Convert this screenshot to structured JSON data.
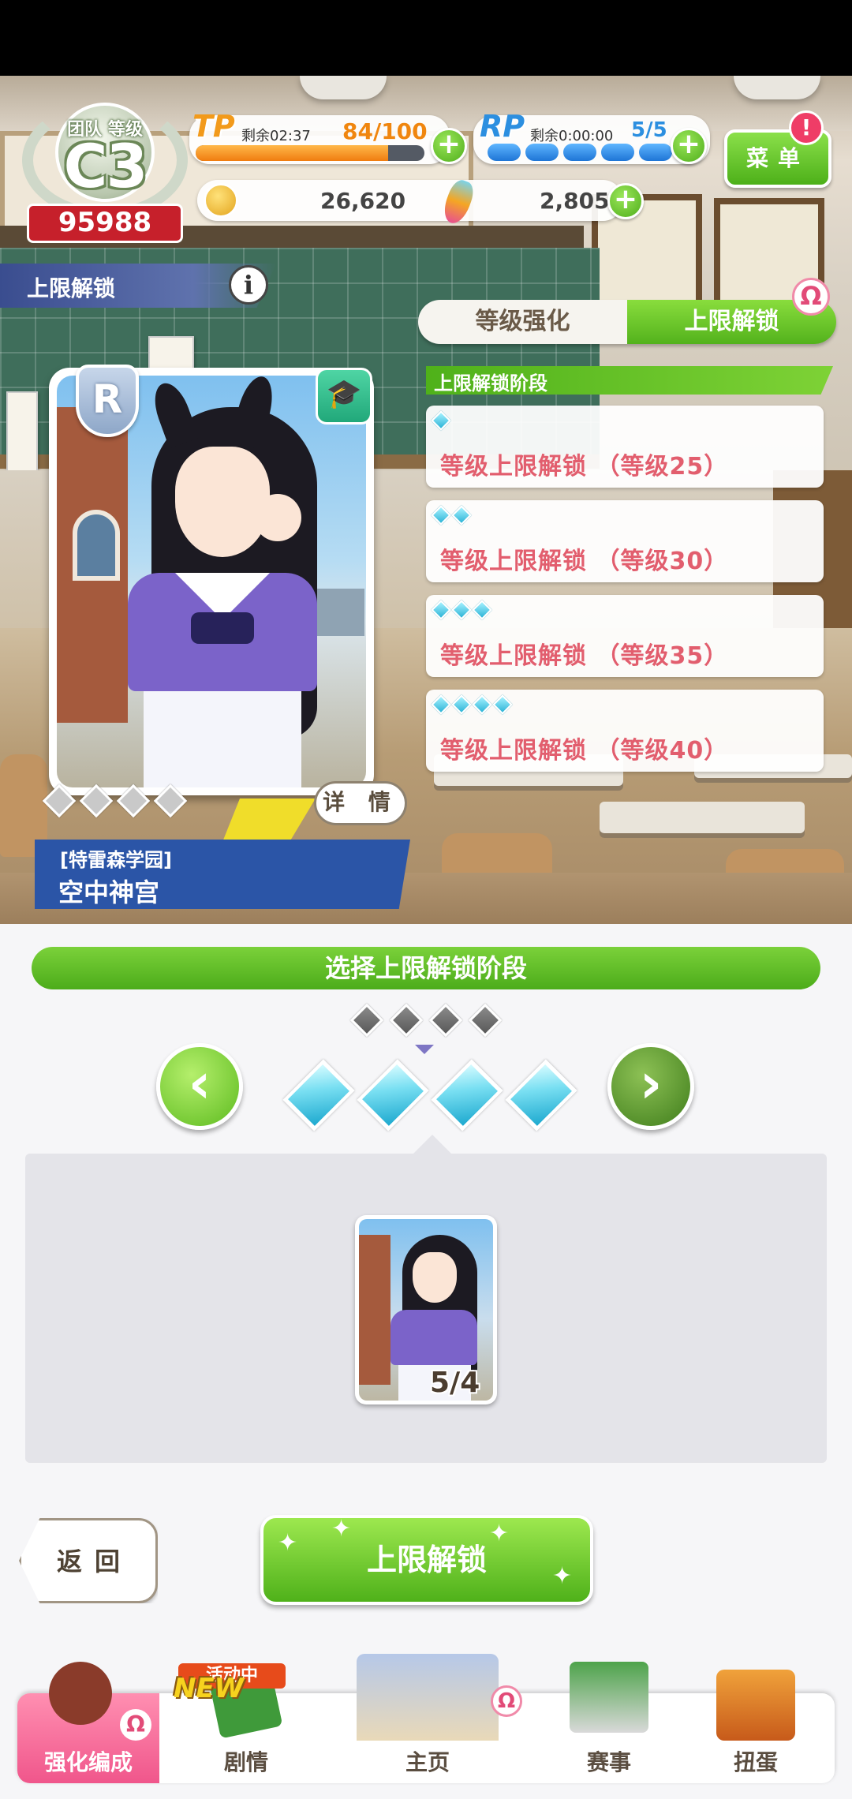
{
  "hud": {
    "team_label": "团队 等级",
    "rank": "C3",
    "score": "95988",
    "tp": {
      "logo": "TP",
      "timer": "剩余02:37",
      "value": "84/100",
      "fill": 0.84
    },
    "rp": {
      "logo": "RP",
      "timer": "剩余0:00:00",
      "value": "5/5",
      "dots": 5
    },
    "coins": "26,620",
    "carrots": "2,805",
    "menu_label": "菜单",
    "menu_alert": "!"
  },
  "page": {
    "title": "上限解锁",
    "info_icon": "i"
  },
  "tabs": [
    {
      "label": "等级强化",
      "active": false
    },
    {
      "label": "上限解锁",
      "active": true
    }
  ],
  "card": {
    "rarity": "R",
    "school": "[特雷森学园]",
    "name": "空中神宫",
    "detail_label": "详 情",
    "type_icon": "graduation-cap"
  },
  "stages": {
    "header": "上限解锁阶段",
    "items": [
      {
        "gems": 1,
        "label": "等级上限解锁 （等级25）"
      },
      {
        "gems": 2,
        "label": "等级上限解锁 （等级30）"
      },
      {
        "gems": 3,
        "label": "等级上限解锁 （等级35）"
      },
      {
        "gems": 4,
        "label": "等级上限解锁 （等级40）"
      }
    ]
  },
  "select": {
    "title": "选择上限解锁阶段",
    "selected_gems": 4,
    "material_count": "5/4"
  },
  "buttons": {
    "back": "返回",
    "unlock": "上限解锁"
  },
  "nav": {
    "items": [
      {
        "label": "强化编成",
        "active": true
      },
      {
        "label": "剧情",
        "active": false
      },
      {
        "label": "主页",
        "active": false
      },
      {
        "label": "赛事",
        "active": false
      },
      {
        "label": "扭蛋",
        "active": false
      }
    ],
    "new_badge": "NEW",
    "active_event": "活动中"
  },
  "colors": {
    "accent_green": "#53b21c",
    "stage_text": "#e25e6e",
    "name_banner": "#2b55a7",
    "nav_active": "#f0568b"
  }
}
